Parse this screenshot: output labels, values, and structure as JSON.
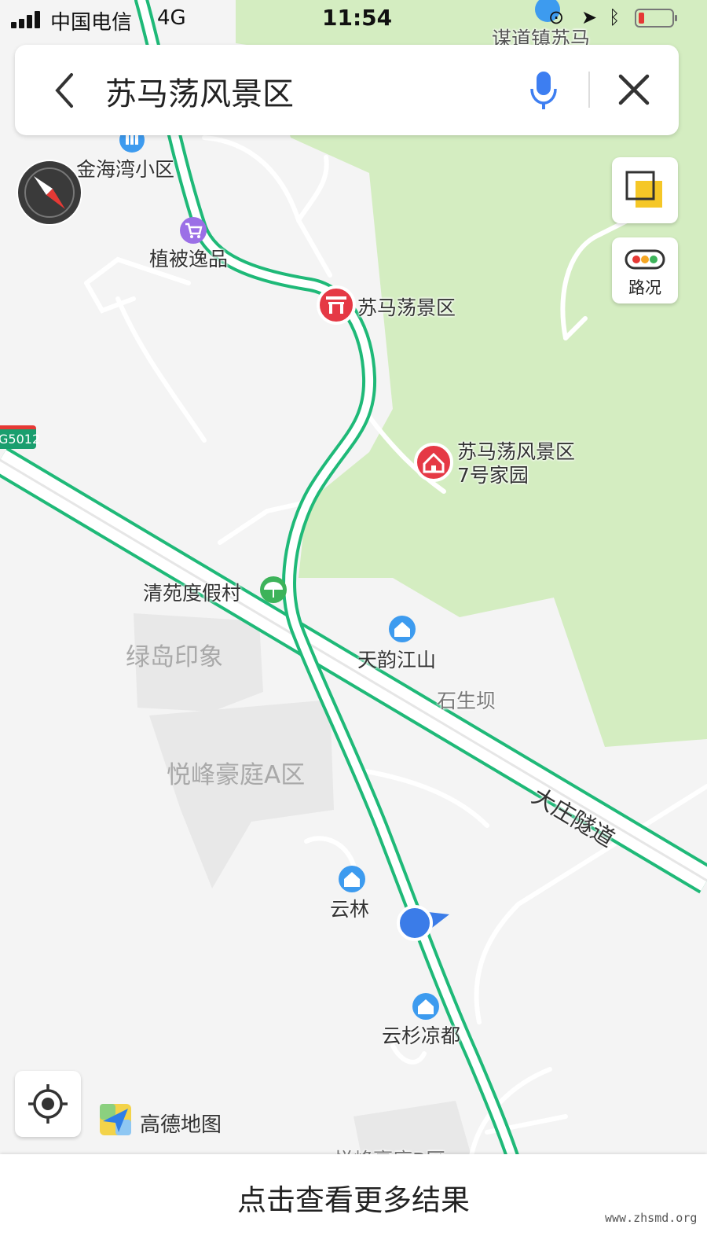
{
  "status_bar": {
    "carrier": "中国电信",
    "network": "4G",
    "time": "11:54"
  },
  "search": {
    "query": "苏马荡风景区"
  },
  "controls": {
    "traffic_label": "路况"
  },
  "map": {
    "route_badge": "G5012",
    "pois": {
      "jinhaiwan": "金海湾小区",
      "zhibei": "植被逸品",
      "scenic_area": "苏马荡景区",
      "home7": "苏马荡风景区7号家园",
      "qingyuan": "清苑度假村",
      "tianyun": "天韵江山",
      "shishengba": "石生坝",
      "yunlin": "云林",
      "yunshan": "云杉凉都",
      "moudao": "谋道镇苏马",
      "yuefeng_b": "悦峰豪庭B区"
    },
    "areas": {
      "lvdao": "绿岛印象",
      "yuefeng_a": "悦峰豪庭A区"
    },
    "roads": {
      "tunnel": "大庄隧道"
    },
    "colors": {
      "route": "#1fb978",
      "forest": "#d4edc1",
      "scenic_marker": "#e53945",
      "poi_blue": "#3d9bef",
      "poi_purple": "#9b6fe6",
      "poi_green": "#3db35a",
      "location": "#3b7ce8"
    }
  },
  "brand": {
    "name": "高德地图"
  },
  "bottom": {
    "more_results": "点击查看更多结果"
  },
  "watermark": "www.zhsmd.org"
}
